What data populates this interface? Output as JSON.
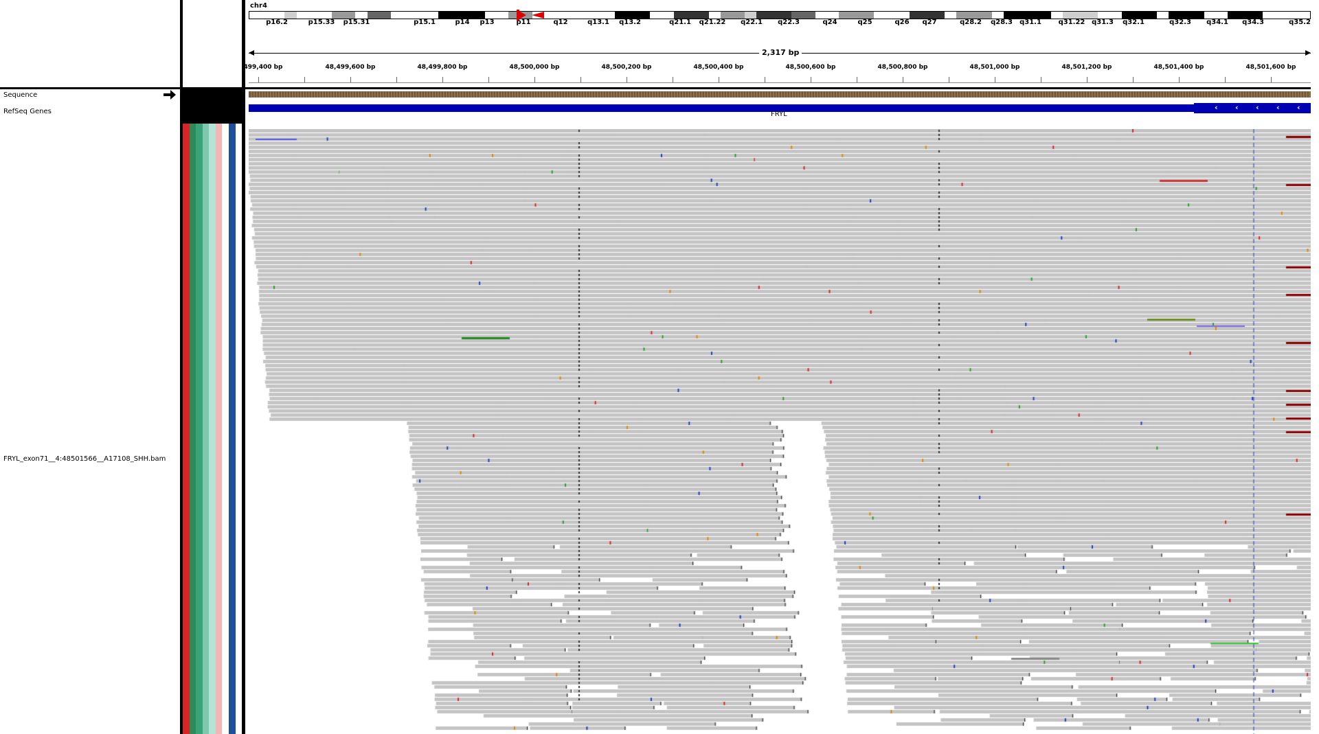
{
  "chromosome": "chr4",
  "ideogram": {
    "bands": [
      {
        "label": "p16.2",
        "color": "#ffffff",
        "w": 3
      },
      {
        "label": "",
        "color": "#cfcfcf",
        "w": 1
      },
      {
        "label": "p15.33",
        "color": "#ffffff",
        "w": 3
      },
      {
        "label": "",
        "color": "#999999",
        "w": 2
      },
      {
        "label": "p15.31",
        "color": "#ffffff",
        "w": 1
      },
      {
        "label": "",
        "color": "#666666",
        "w": 2
      },
      {
        "label": "",
        "color": "#ffffff",
        "w": 4
      },
      {
        "label": "p15.1",
        "color": "#000000",
        "w": 4
      },
      {
        "label": "p14",
        "color": "#ffffff",
        "w": 2
      },
      {
        "label": "p13",
        "color": "#999999",
        "w": 2
      },
      {
        "label": "",
        "color": "#ffffff",
        "w": 2
      },
      {
        "label": "p11",
        "color": "#ffffff",
        "w": 2
      },
      {
        "label": "q12",
        "color": "#ffffff",
        "w": 3
      },
      {
        "label": "q13.1",
        "color": "#000000",
        "w": 3
      },
      {
        "label": "q13.2",
        "color": "#ffffff",
        "w": 2
      },
      {
        "label": "",
        "color": "#333333",
        "w": 3
      },
      {
        "label": "q21.1",
        "color": "#ffffff",
        "w": 1
      },
      {
        "label": "q21.22",
        "color": "#999999",
        "w": 2
      },
      {
        "label": "",
        "color": "#cfcfcf",
        "w": 1
      },
      {
        "label": "q22.1",
        "color": "#333333",
        "w": 3
      },
      {
        "label": "q22.3",
        "color": "#666666",
        "w": 2
      },
      {
        "label": "",
        "color": "#ffffff",
        "w": 2
      },
      {
        "label": "q24",
        "color": "#999999",
        "w": 3
      },
      {
        "label": "q25",
        "color": "#ffffff",
        "w": 3
      },
      {
        "label": "q26",
        "color": "#333333",
        "w": 3
      },
      {
        "label": "q27",
        "color": "#ffffff",
        "w": 1
      },
      {
        "label": "",
        "color": "#999999",
        "w": 3
      },
      {
        "label": "q28.2",
        "color": "#ffffff",
        "w": 1
      },
      {
        "label": "q28.3",
        "color": "#000000",
        "w": 4
      },
      {
        "label": "q31.1",
        "color": "#ffffff",
        "w": 1
      },
      {
        "label": "q31.22",
        "color": "#cfcfcf",
        "w": 3
      },
      {
        "label": "q31.3",
        "color": "#ffffff",
        "w": 2
      },
      {
        "label": "q32.1",
        "color": "#000000",
        "w": 3
      },
      {
        "label": "",
        "color": "#ffffff",
        "w": 1
      },
      {
        "label": "q32.3",
        "color": "#000000",
        "w": 3
      },
      {
        "label": "q34.1",
        "color": "#ffffff",
        "w": 2
      },
      {
        "label": "q34.3",
        "color": "#000000",
        "w": 3
      },
      {
        "label": "q35.2",
        "color": "#ffffff",
        "w": 4
      }
    ],
    "band_labels": [
      {
        "label": "p16.2",
        "pos": 403
      },
      {
        "label": "p15.33",
        "pos": 468
      },
      {
        "label": "p15.31",
        "pos": 519
      },
      {
        "label": "p15.1",
        "pos": 618
      },
      {
        "label": "p14",
        "pos": 673
      },
      {
        "label": "p13",
        "pos": 709
      },
      {
        "label": "p11",
        "pos": 762
      },
      {
        "label": "q12",
        "pos": 816
      },
      {
        "label": "q13.1",
        "pos": 871
      },
      {
        "label": "q13.2",
        "pos": 917
      },
      {
        "label": "q21.1",
        "pos": 990
      },
      {
        "label": "q21.22",
        "pos": 1037
      },
      {
        "label": "q22.1",
        "pos": 1094
      },
      {
        "label": "q22.3",
        "pos": 1148
      },
      {
        "label": "q24",
        "pos": 1208
      },
      {
        "label": "q25",
        "pos": 1259
      },
      {
        "label": "q26",
        "pos": 1313
      },
      {
        "label": "q27",
        "pos": 1353
      },
      {
        "label": "q28.2",
        "pos": 1413
      },
      {
        "label": "q28.3",
        "pos": 1458
      },
      {
        "label": "q31.1",
        "pos": 1500
      },
      {
        "label": "q31.22",
        "pos": 1560
      },
      {
        "label": "q31.3",
        "pos": 1605
      },
      {
        "label": "q32.1",
        "pos": 1650
      },
      {
        "label": "q32.3",
        "pos": 1718
      },
      {
        "label": "q34.1",
        "pos": 1772
      },
      {
        "label": "q34.3",
        "pos": 1824
      },
      {
        "label": "q35.2",
        "pos": 1892
      }
    ],
    "centromere_color": "#e00000"
  },
  "ruler": {
    "span_label": "2,317 bp",
    "tick_labels": [
      {
        "label": "499,400 bp",
        "pos": 383
      },
      {
        "label": "48,499,600 bp",
        "pos": 510
      },
      {
        "label": "48,499,800 bp",
        "pos": 644
      },
      {
        "label": "48,500,000 bp",
        "pos": 778
      },
      {
        "label": "48,500,200 bp",
        "pos": 912
      },
      {
        "label": "48,500,400 bp",
        "pos": 1046
      },
      {
        "label": "48,500,600 bp",
        "pos": 1180
      },
      {
        "label": "48,500,800 bp",
        "pos": 1314
      },
      {
        "label": "48,501,000 bp",
        "pos": 1448
      },
      {
        "label": "48,501,200 bp",
        "pos": 1582
      },
      {
        "label": "48,501,400 bp",
        "pos": 1716
      },
      {
        "label": "48,501,600 bp",
        "pos": 1850
      }
    ]
  },
  "tracks": {
    "sequence_label": "Sequence",
    "refseq_label": "RefSeq Genes",
    "gene_name": "FRYL",
    "bam_label": "FRYL_exon71__4:48501566__A17108_SHH.bam"
  },
  "attribute_colors": [
    "#d62728",
    "#2e8b57",
    "#3aa37a",
    "#7fc8b0",
    "#b7e3d6",
    "#f4b6b2",
    "#ffffff",
    "#1f4e9c",
    "#ffffff"
  ],
  "colors": {
    "read": "#c4c4c4",
    "gene": "#0000b3",
    "background": "#ffffff"
  }
}
